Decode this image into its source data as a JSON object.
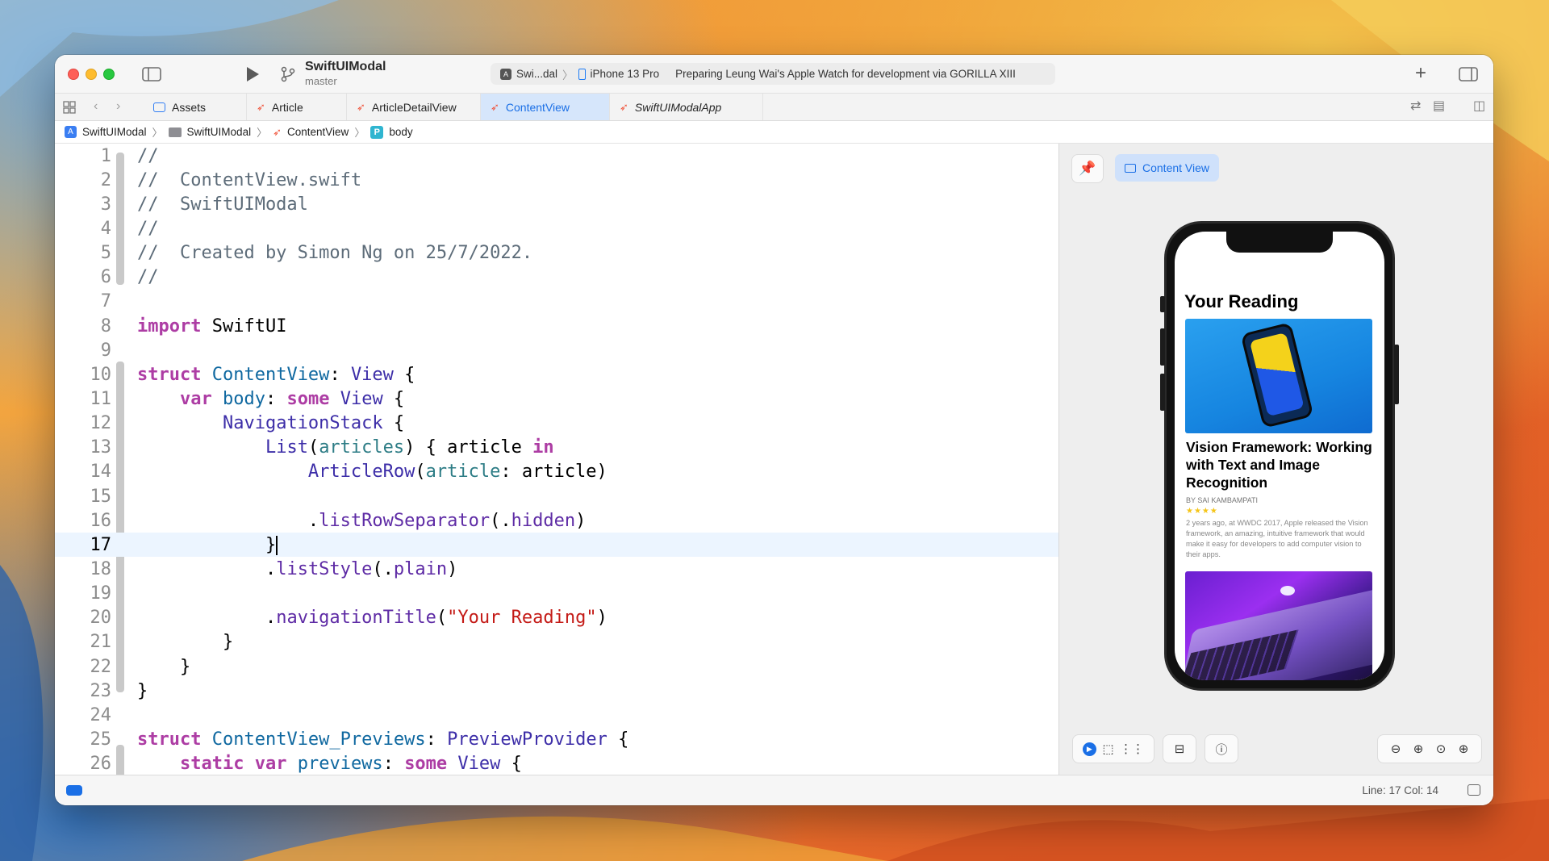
{
  "toolbar": {
    "project_name": "SwiftUIModal",
    "branch": "master",
    "scheme": "Swi...dal",
    "device": "iPhone 13 Pro",
    "status": "Preparing Leung Wai's Apple Watch for development via GORILLA XIII",
    "add_symbol": "+"
  },
  "tabs": [
    {
      "label": "Assets",
      "icon": "assets-icon"
    },
    {
      "label": "Article",
      "icon": "swift-icon"
    },
    {
      "label": "ArticleDetailView",
      "icon": "swift-icon"
    },
    {
      "label": "ContentView",
      "icon": "swift-icon",
      "active": true
    },
    {
      "label": "SwiftUIModalApp",
      "icon": "swift-icon"
    }
  ],
  "jumpbar": [
    "SwiftUIModal",
    "SwiftUIModal",
    "ContentView",
    "body"
  ],
  "editor": {
    "current_line": 17,
    "lines": [
      {
        "n": "1"
      },
      {
        "n": "2"
      },
      {
        "n": "3"
      },
      {
        "n": "4"
      },
      {
        "n": "5"
      },
      {
        "n": "6"
      },
      {
        "n": "7"
      },
      {
        "n": "8"
      },
      {
        "n": "9"
      },
      {
        "n": "10"
      },
      {
        "n": "11"
      },
      {
        "n": "12"
      },
      {
        "n": "13"
      },
      {
        "n": "14"
      },
      {
        "n": "15"
      },
      {
        "n": "16"
      },
      {
        "n": "17"
      },
      {
        "n": "18"
      },
      {
        "n": "19"
      },
      {
        "n": "20"
      },
      {
        "n": "21"
      },
      {
        "n": "22"
      },
      {
        "n": "23"
      },
      {
        "n": "24"
      },
      {
        "n": "25"
      },
      {
        "n": "26"
      }
    ],
    "text": {
      "c1": "//",
      "c2": "//  ContentView.swift",
      "c3": "//  SwiftUIModal",
      "c4": "//",
      "c5": "//  Created by Simon Ng on 25/7/2022.",
      "c6": "//",
      "import": "import",
      "swiftui": " SwiftUI",
      "struct": "struct",
      "contentview": " ContentView",
      "colon": ": ",
      "view": "View",
      "brace_open": " {",
      "var": "var",
      "body": " body",
      "some": "some",
      "navstack": "NavigationStack",
      "list": "List",
      "paren_open": "(",
      "articles": "articles",
      "paren_close_brace": ") { article ",
      "in": "in",
      "articlerow": "ArticleRow",
      "article_label": "article",
      "article_arg": ": article)",
      "dot": ".",
      "listRowSeparator": "listRowSeparator",
      "hidden_open": "(.",
      "hidden": "hidden",
      "close_paren": ")",
      "close_brace": "}",
      "listStyle": "listStyle",
      "plain": "plain",
      "navigationTitle": "navigationTitle",
      "title_str": "\"Your Reading\"",
      "previews_struct": " ContentView_Previews",
      "previewprovider": "PreviewProvider",
      "static": "static",
      "previews": " previews"
    }
  },
  "canvas": {
    "chip_label": "Content View",
    "preview": {
      "nav_title": "Your Reading",
      "article_title": "Vision Framework: Working with Text and Image Recognition",
      "byline": "BY SAI KAMBAMPATI",
      "stars": "★★★★",
      "excerpt": "2 years ago, at WWDC 2017, Apple released the Vision framework, an amazing, intuitive framework that would make it easy for developers to add computer vision to their apps."
    }
  },
  "statusbar": {
    "position": "Line: 17  Col: 14"
  },
  "colors": {
    "accent": "#1a6fe6",
    "keyword": "#ad3da4",
    "string": "#c41a16",
    "swift_icon": "#f05138"
  }
}
